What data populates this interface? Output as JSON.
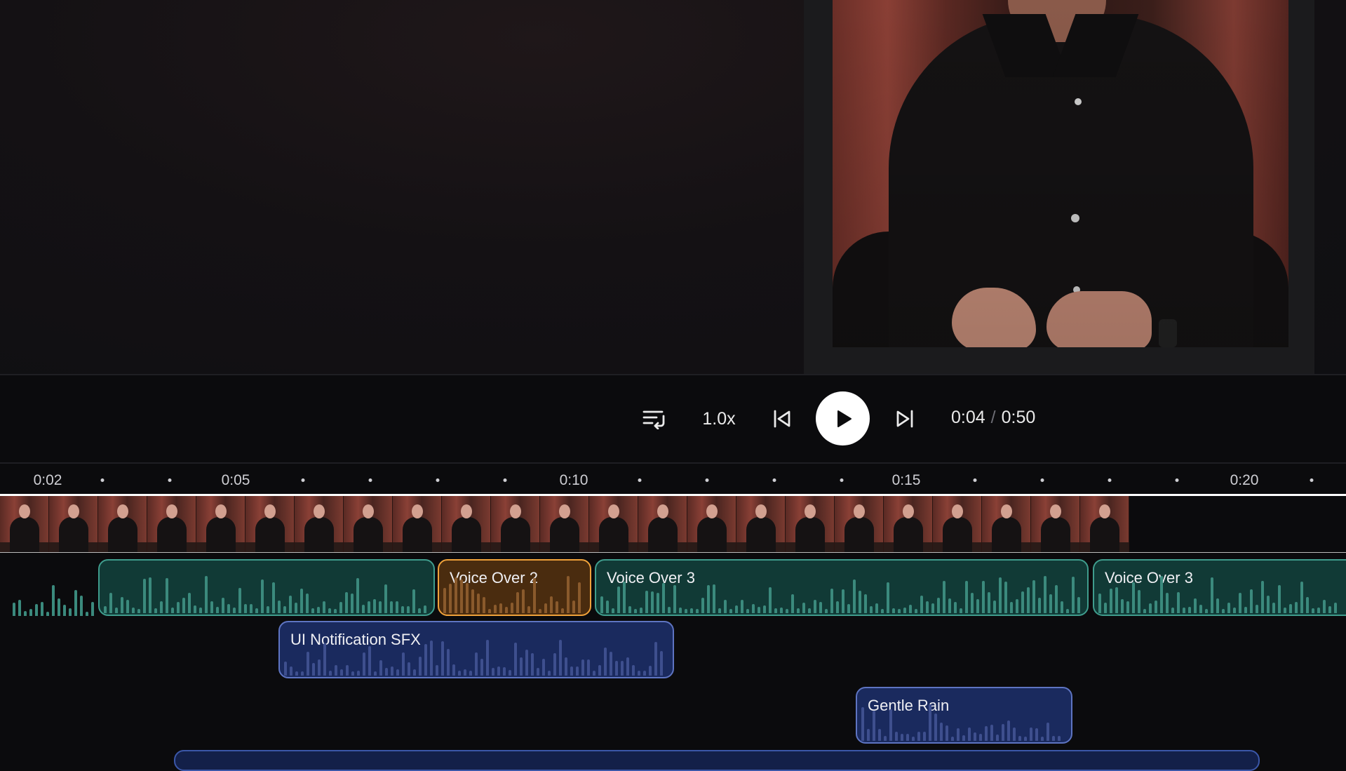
{
  "player": {
    "speed": "1.0x",
    "current_time": "0:04",
    "separator": "/",
    "total_time": "0:50",
    "icons": {
      "playlist": "playlist-icon",
      "previous": "skip-previous-icon",
      "play": "play-icon",
      "next": "skip-next-icon"
    }
  },
  "ruler": {
    "labels": [
      "0:02",
      "0:05",
      "0:10",
      "0:15",
      "0:20"
    ]
  },
  "tracks": {
    "video": {
      "frames": 23
    },
    "audio": [
      {
        "label": "",
        "color": "teal"
      },
      {
        "label": "Voice Over 2",
        "color": "orange"
      },
      {
        "label": "Voice Over 3",
        "color": "teal"
      },
      {
        "label": "Voice Over 3",
        "color": "teal"
      },
      {
        "label": "UI Notification SFX",
        "color": "navy"
      },
      {
        "label": "Gentle Rain",
        "color": "navy"
      }
    ]
  },
  "colors": {
    "teal_fill": "#113a36",
    "teal_border": "#3f9d8d",
    "orange_fill": "#4a2c0f",
    "orange_border": "#f0a23a",
    "navy_fill": "#1a2a5e",
    "navy_border": "#5e74c2"
  }
}
